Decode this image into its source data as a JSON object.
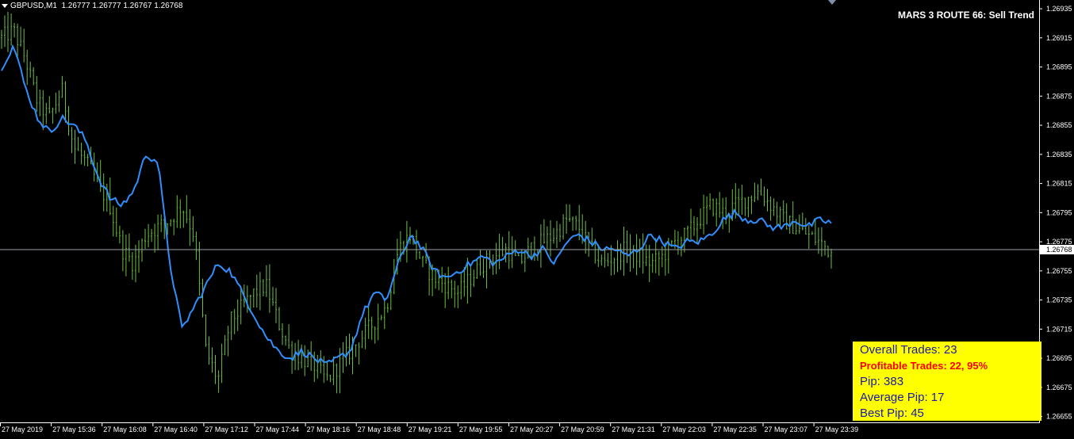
{
  "symbol": {
    "name": "GBPUSD,M1",
    "ohlc": "1.26777 1.26777 1.26767 1.26768"
  },
  "ea_title": "MARS 3 ROUTE 66: Sell Trend",
  "stats": {
    "overall_trades": "Overall Trades: 23",
    "profitable_trades": "Profitable Trades: 22, 95%",
    "pip": "Pip: 383",
    "average_pip": "Average Pip: 17",
    "best_pip": "Best Pip: 45"
  },
  "colors": {
    "background": "#000000",
    "bars": "#6fbf3f",
    "ma_line": "#2f8fff",
    "grid_axis": "#ffffff",
    "current_price_line": "#9aa0a6",
    "stats_bg": "#ffff00",
    "stats_text": "#1a1aa6",
    "stats_highlight": "#ff0000"
  },
  "chart_data": {
    "type": "line",
    "title": "",
    "current_price": 1.26768,
    "current_price_label": "1.26768",
    "y_ticks": [
      "1.26935",
      "1.26915",
      "1.26895",
      "1.26875",
      "1.26855",
      "1.26835",
      "1.26815",
      "1.26795",
      "1.26775",
      "1.26755",
      "1.26735",
      "1.26715",
      "1.26695",
      "1.26675",
      "1.26655"
    ],
    "ylim": [
      1.26651,
      1.26941
    ],
    "x_ticks": [
      "27 May 2019",
      "27 May 15:36",
      "27 May 16:08",
      "27 May 16:40",
      "27 May 17:12",
      "27 May 17:44",
      "27 May 18:16",
      "27 May 18:48",
      "27 May 19:21",
      "27 May 19:55",
      "27 May 20:27",
      "27 May 20:59",
      "27 May 21:31",
      "27 May 22:03",
      "27 May 22:35",
      "27 May 23:07",
      "27 May 23:39"
    ],
    "series": [
      {
        "type": "bar",
        "color": "#6fbf3f",
        "close_profile": [
          1.26915,
          1.2692,
          1.269,
          1.2687,
          1.2686,
          1.2688,
          1.2684,
          1.2683,
          1.26815,
          1.268,
          1.2677,
          1.2676,
          1.2678,
          1.26785,
          1.2679,
          1.268,
          1.2678,
          1.267,
          1.2668,
          1.2672,
          1.2673,
          1.2674,
          1.26745,
          1.2672,
          1.267,
          1.26695,
          1.2669,
          1.2668,
          1.2669,
          1.267,
          1.2671,
          1.2672,
          1.2673,
          1.2677,
          1.2678,
          1.2676,
          1.2675,
          1.26745,
          1.2674,
          1.2675,
          1.2676,
          1.26765,
          1.2677,
          1.2676,
          1.2677,
          1.26775,
          1.2678,
          1.2679,
          1.26785,
          1.2677,
          1.2676,
          1.26765,
          1.2677,
          1.26765,
          1.2676,
          1.26765,
          1.26775,
          1.2678,
          1.2679,
          1.268,
          1.26795,
          1.268,
          1.26805,
          1.2681,
          1.268,
          1.2679,
          1.26785,
          1.2678,
          1.26775,
          1.26768
        ]
      },
      {
        "type": "line",
        "color": "#2f8fff",
        "values": [
          1.26895,
          1.2691,
          1.2688,
          1.2686,
          1.2685,
          1.2686,
          1.26855,
          1.26845,
          1.2682,
          1.26805,
          1.268,
          1.2681,
          1.26835,
          1.2683,
          1.2676,
          1.26715,
          1.2673,
          1.26745,
          1.2676,
          1.26755,
          1.2674,
          1.26725,
          1.2671,
          1.267,
          1.26695,
          1.267,
          1.26695,
          1.2669,
          1.26695,
          1.267,
          1.26725,
          1.2674,
          1.26735,
          1.2676,
          1.2678,
          1.2677,
          1.26755,
          1.2675,
          1.26755,
          1.2676,
          1.26765,
          1.2676,
          1.26765,
          1.2677,
          1.26765,
          1.2677,
          1.2676,
          1.26775,
          1.2678,
          1.26775,
          1.2677,
          1.2677,
          1.26765,
          1.2677,
          1.2678,
          1.26775,
          1.2677,
          1.26775,
          1.26775,
          1.2678,
          1.2679,
          1.26795,
          1.2679,
          1.2679,
          1.26785,
          1.26785,
          1.2679,
          1.26785,
          1.2679,
          1.26788
        ]
      }
    ]
  }
}
